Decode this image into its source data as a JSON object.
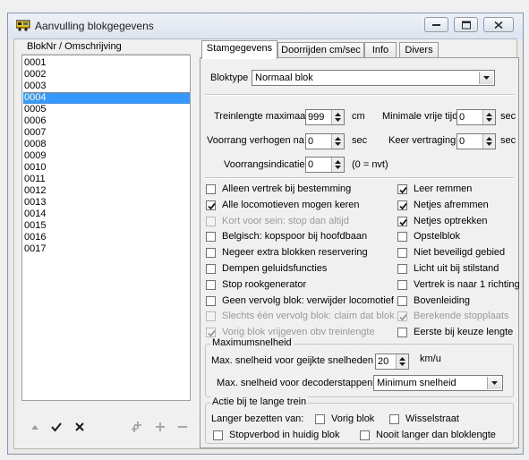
{
  "window": {
    "title": "Aanvulling blokgegevens"
  },
  "list": {
    "header": "BlokNr / Omschrijving",
    "items": [
      "0001",
      "0002",
      "0003",
      "0004",
      "0005",
      "0006",
      "0007",
      "0008",
      "0009",
      "0010",
      "0011",
      "0012",
      "0013",
      "0014",
      "0015",
      "0016",
      "0017"
    ],
    "selected": "0004"
  },
  "toolbar_icons": [
    "up-arrow-icon",
    "checkmark-icon",
    "cross-icon",
    "multi-add-icon",
    "plus-icon",
    "minus-icon"
  ],
  "tabs": [
    "Stamgegevens",
    "Doorrijden cm/sec",
    "Info",
    "Divers"
  ],
  "active_tab": "Stamgegevens",
  "form": {
    "bloktype_label": "Bloktype",
    "bloktype_value": "Normaal blok",
    "treinlengte_label": "Treinlengte maximaal",
    "treinlengte_value": "999",
    "treinlengte_unit": "cm",
    "vrije_tijd_label": "Minimale vrije tijd",
    "vrije_tijd_value": "0",
    "vrije_tijd_unit": "sec",
    "voorrang_label": "Voorrang verhogen na",
    "voorrang_value": "0",
    "voorrang_unit": "sec",
    "vertraging_label": "Keer vertraging",
    "vertraging_value": "0",
    "vertraging_unit": "sec",
    "indicatie_label": "Voorrangsindicatie",
    "indicatie_value": "0",
    "indicatie_note": "(0 = nvt)"
  },
  "checkboxes_left": [
    {
      "label": "Alleen vertrek bij bestemming",
      "checked": false,
      "disabled": false
    },
    {
      "label": "Alle locomotieven mogen keren",
      "checked": true,
      "disabled": false
    },
    {
      "label": "Kort voor sein: stop dan altijd",
      "checked": false,
      "disabled": true
    },
    {
      "label": "Belgisch: kopspoor bij hoofdbaan",
      "checked": false,
      "disabled": false
    },
    {
      "label": "Negeer extra blokken reservering",
      "checked": false,
      "disabled": false
    },
    {
      "label": "Dempen geluidsfuncties",
      "checked": false,
      "disabled": false
    },
    {
      "label": "Stop rookgenerator",
      "checked": false,
      "disabled": false
    },
    {
      "label": "Geen vervolg blok: verwijder locomotief",
      "checked": false,
      "disabled": false
    },
    {
      "label": "Slechts één vervolg blok: claim dat blok",
      "checked": false,
      "disabled": true
    },
    {
      "label": "Vorig blok vrijgeven obv treinlengte",
      "checked": true,
      "disabled": true
    }
  ],
  "checkboxes_right": [
    {
      "label": "Leer remmen",
      "checked": true,
      "disabled": false
    },
    {
      "label": "Netjes afremmen",
      "checked": true,
      "disabled": false
    },
    {
      "label": "Netjes optrekken",
      "checked": true,
      "disabled": false
    },
    {
      "label": "Opstelblok",
      "checked": false,
      "disabled": false
    },
    {
      "label": "Niet beveiligd gebied",
      "checked": false,
      "disabled": false
    },
    {
      "label": "Licht uit bij stilstand",
      "checked": false,
      "disabled": false
    },
    {
      "label": "Vertrek is naar 1 richting",
      "checked": false,
      "disabled": false
    },
    {
      "label": "Bovenleiding",
      "checked": false,
      "disabled": false
    },
    {
      "label": "Berekende stopplaats",
      "checked": true,
      "disabled": true
    },
    {
      "label": "Eerste bij keuze lengte",
      "checked": false,
      "disabled": false
    }
  ],
  "max_speed": {
    "title": "Maximumsnelheid",
    "geijkt_label": "Max. snelheid voor geijkte snelheden",
    "geijkt_value": "20",
    "geijkt_unit": "km/u",
    "decoder_label": "Max. snelheid voor decoderstappen",
    "decoder_value": "Minimum snelheid"
  },
  "action": {
    "title": "Actie bij te lange trein",
    "langer_label": "Langer bezetten van:",
    "vorig_blok": "Vorig blok",
    "wisselstraat": "Wisselstraat",
    "stopverbod": "Stopverbod in huidig blok",
    "nooit_langer": "Nooit langer dan bloklengte"
  }
}
